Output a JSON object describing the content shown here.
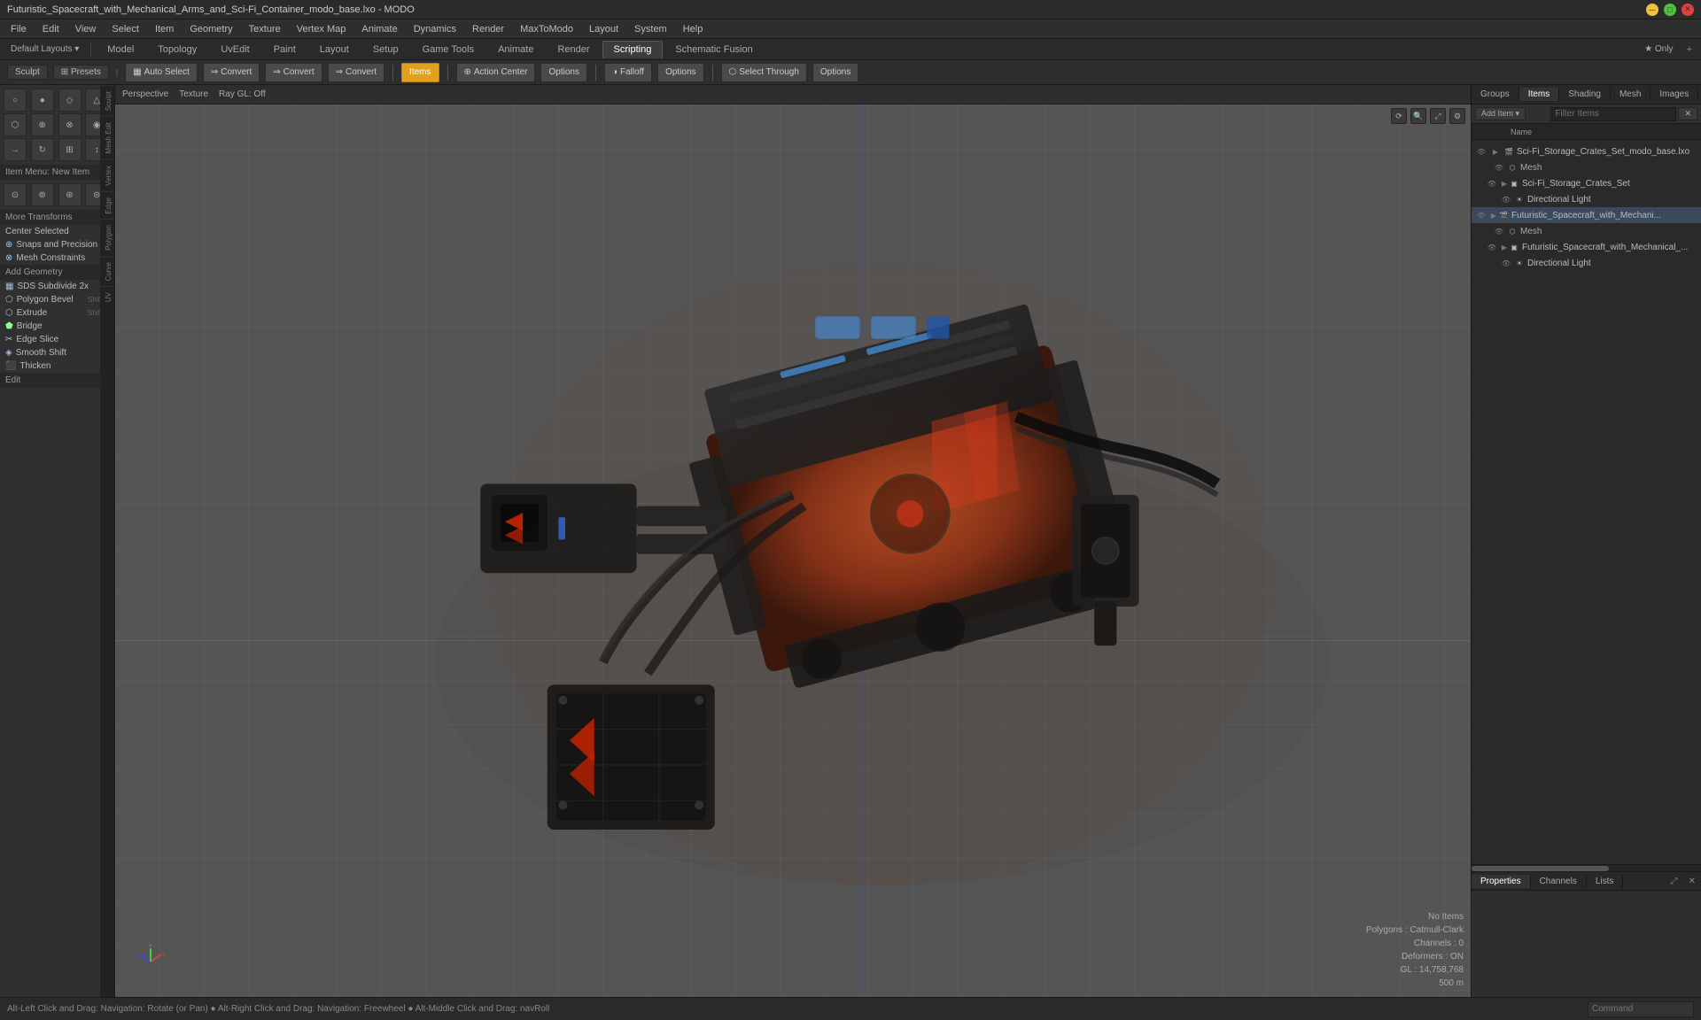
{
  "titlebar": {
    "title": "Futuristic_Spacecraft_with_Mechanical_Arms_and_Sci-Fi_Container_modo_base.lxo - MODO"
  },
  "menubar": {
    "items": [
      "File",
      "Edit",
      "View",
      "Select",
      "Item",
      "Geometry",
      "Texture",
      "Vertex Map",
      "Animate",
      "Dynamics",
      "Render",
      "MaxToModo",
      "Layout",
      "System",
      "Help"
    ]
  },
  "tabs": {
    "items": [
      "Model",
      "Topology",
      "UvEdit",
      "Paint",
      "Layout",
      "Setup",
      "Game Tools",
      "Animate",
      "Render",
      "Scripting",
      "Schematic Fusion"
    ],
    "active": "Model",
    "add_label": "+"
  },
  "sculpt_bar": {
    "sculpt_label": "Sculpt",
    "presets_label": "Presets"
  },
  "toolbar": {
    "auto_select": "Auto Select",
    "convert1": "Convert",
    "convert2": "Convert",
    "convert3": "Convert",
    "items_label": "Items",
    "action_center": "Action Center",
    "options1": "Options",
    "falloff": "Falloff",
    "options2": "Options",
    "select_through": "Select Through",
    "options3": "Options"
  },
  "viewport": {
    "perspective_label": "Perspective",
    "texture_label": "Texture",
    "ray_label": "Ray GL: Off",
    "controls": [
      "⟳",
      "🔍",
      "⤢",
      "⚙"
    ]
  },
  "left_sidebar": {
    "toolbox_icons": [
      "○",
      "●",
      "◇",
      "△",
      "⬡",
      "⊕",
      "⊗",
      "◉",
      "→",
      "↻",
      "⊞",
      "↕"
    ],
    "item_menu_label": "Item Menu: New Item",
    "more_transforms_label": "More Transforms",
    "center_selected_label": "Center Selected",
    "snaps_precision_label": "Snaps and Precision",
    "mesh_constraints_label": "Mesh Constraints",
    "add_geometry_label": "Add Geometry",
    "tools": [
      {
        "label": "SDS Subdivide 2x",
        "icon": "▦"
      },
      {
        "label": "Polygon Bevel",
        "icon": "⬠",
        "shortcut": "Shift-B"
      },
      {
        "label": "Extrude",
        "icon": "⬡",
        "shortcut": "Shift-X"
      },
      {
        "label": "Bridge",
        "icon": "⬟"
      },
      {
        "label": "Edge Slice",
        "icon": "✂"
      },
      {
        "label": "Smooth Shift",
        "icon": "◈"
      },
      {
        "label": "Thicken",
        "icon": "⬛"
      }
    ],
    "edit_label": "Edit",
    "vtabs": [
      "Sculpt",
      "Mesh Edit",
      "Vertex",
      "Edge",
      "Polygon",
      "Curve",
      "UV"
    ]
  },
  "right_panel": {
    "tabs": [
      "Groups",
      "Items",
      "Shading",
      "Mesh",
      "Images"
    ],
    "active_tab": "Items",
    "add_item_label": "Add Item",
    "filter_placeholder": "Filter Items",
    "columns": [
      "",
      "Name"
    ],
    "tree": [
      {
        "level": 0,
        "expanded": true,
        "label": "Sci-Fi_Storage_Crates_Set_modo_base.lxo",
        "type": "scene",
        "visible": true
      },
      {
        "level": 1,
        "expanded": true,
        "label": "Mesh",
        "type": "mesh",
        "visible": true
      },
      {
        "level": 1,
        "label": "Sci-Fi_Storage_Crates_Set",
        "type": "group",
        "visible": true,
        "expanded": false
      },
      {
        "level": 2,
        "label": "Directional Light",
        "type": "light",
        "visible": true
      },
      {
        "level": 0,
        "expanded": true,
        "label": "Futuristic_Spacecraft_with_Mechani...",
        "type": "scene",
        "visible": true,
        "selected": true
      },
      {
        "level": 1,
        "label": "Mesh",
        "type": "mesh",
        "visible": true
      },
      {
        "level": 1,
        "label": "Futuristic_Spacecraft_with_Mechanical_...",
        "type": "group",
        "visible": true,
        "expanded": false
      },
      {
        "level": 2,
        "label": "Directional Light",
        "type": "light",
        "visible": true
      }
    ],
    "lower_tabs": [
      "Properties",
      "Channels",
      "Lists"
    ],
    "active_lower_tab": "Properties"
  },
  "stats": {
    "no_items": "No Items",
    "polygons_label": "Polygons :",
    "polygons_value": "Catmull-Clark",
    "channels_label": "Channels :",
    "channels_value": "0",
    "deformers_label": "Deformers :",
    "deformers_value": "ON",
    "gl_label": "GL :",
    "gl_value": "14,758,768",
    "size_value": "500 m"
  },
  "status_bar": {
    "message": "Alt-Left Click and Drag: Navigation: Rotate (or Pan)  ●  Alt-Right Click and Drag: Navigation: Freewheel  ●  Alt-Middle Click and Drag: navRoll",
    "command_placeholder": "Command"
  }
}
